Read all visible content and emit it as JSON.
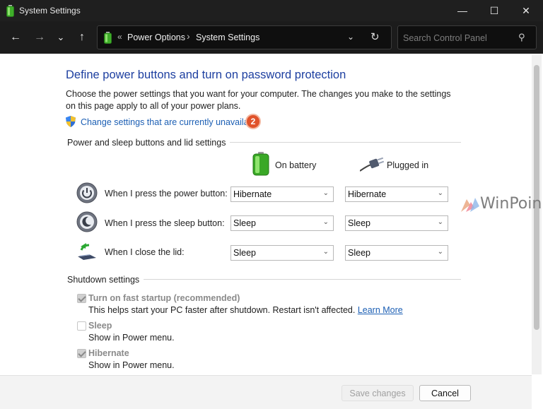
{
  "window": {
    "title": "System Settings",
    "controls": {
      "minimize": "—",
      "maximize": "☐",
      "close": "✕"
    }
  },
  "nav": {
    "back_icon": "←",
    "forward_icon": "→",
    "recent_icon": "⌄",
    "up_icon": "↑",
    "breadcrumb_sep": "«",
    "breadcrumb": [
      "Power Options",
      "System Settings"
    ],
    "crumb_sep": "›",
    "dropdown_icon": "⌄",
    "refresh_icon": "↻",
    "search_placeholder": "Search Control Panel",
    "search_icon": "⚲"
  },
  "page": {
    "heading": "Define power buttons and turn on password protection",
    "description": "Choose the power settings that you want for your computer. The changes you make to the settings on this page apply to all of your power plans.",
    "change_link": "Change settings that are currently unavailable",
    "badge": "2"
  },
  "buttons_section": {
    "title": "Power and sleep buttons and lid settings",
    "col_battery": "On battery",
    "col_plugged": "Plugged in",
    "rows": [
      {
        "label": "When I press the power button:",
        "battery": "Hibernate",
        "plugged": "Hibernate",
        "icon": "power-button-icon"
      },
      {
        "label": "When I press the sleep button:",
        "battery": "Sleep",
        "plugged": "Sleep",
        "icon": "sleep-button-icon"
      },
      {
        "label": "When I close the lid:",
        "battery": "Sleep",
        "plugged": "Sleep",
        "icon": "laptop-lid-icon"
      }
    ]
  },
  "shutdown": {
    "title": "Shutdown settings",
    "items": [
      {
        "label": "Turn on fast startup (recommended)",
        "checked": true,
        "sub": "This helps start your PC faster after shutdown. Restart isn't affected.",
        "link": "Learn More"
      },
      {
        "label": "Sleep",
        "checked": false,
        "sub": "Show in Power menu."
      },
      {
        "label": "Hibernate",
        "checked": true,
        "sub": "Show in Power menu."
      }
    ]
  },
  "footer": {
    "save": "Save changes",
    "cancel": "Cancel"
  },
  "watermark": "WinPoin",
  "colors": {
    "heading": "#1d3fa0",
    "link": "#1c5fb4",
    "badge": "#e0522a",
    "titlebar": "#1f1f1f"
  }
}
